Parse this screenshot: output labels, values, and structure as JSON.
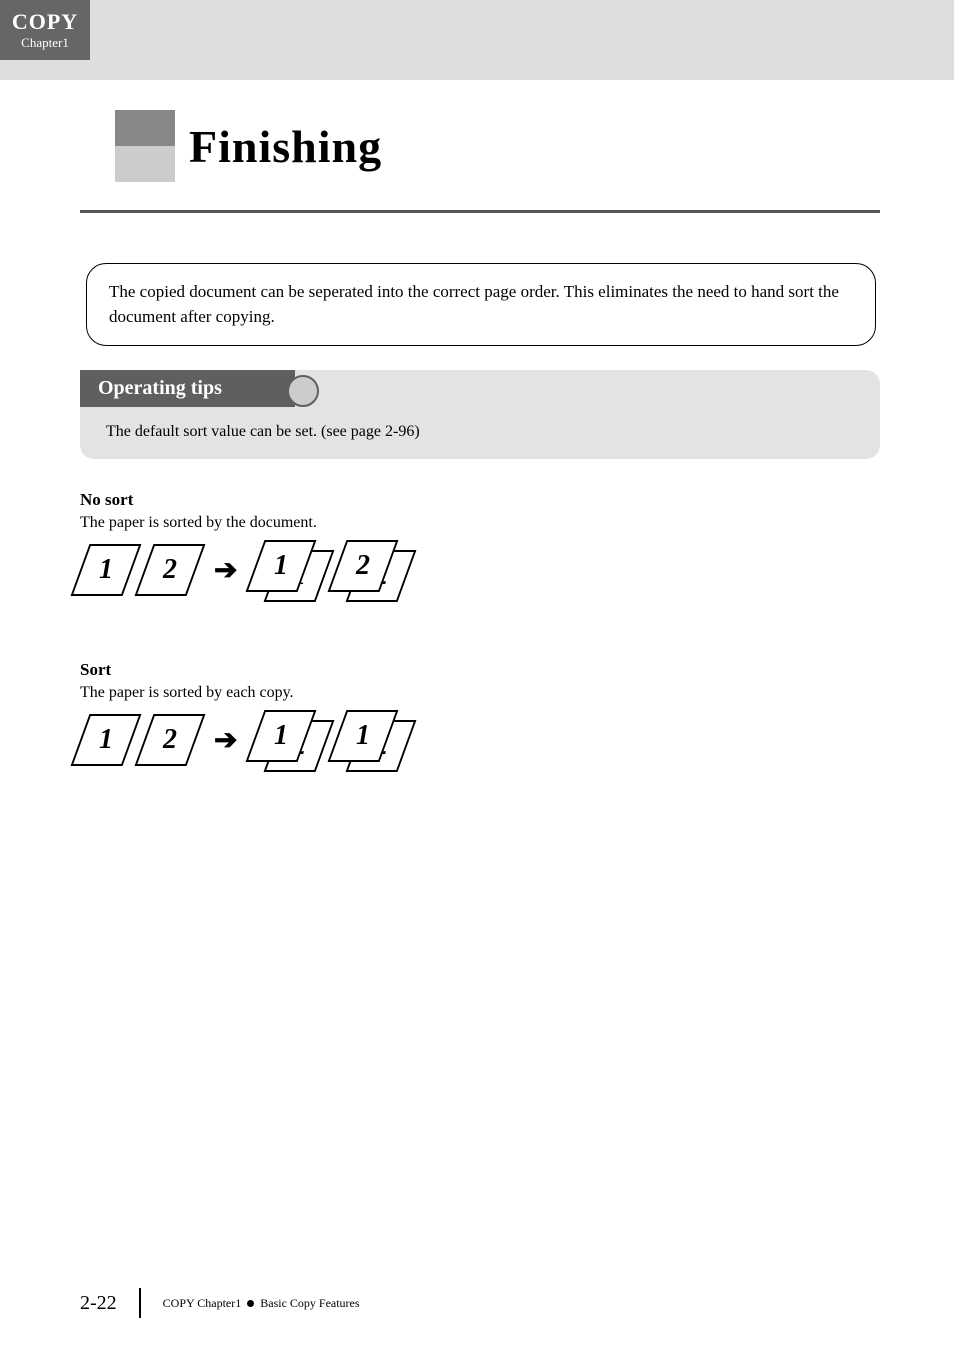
{
  "tab": {
    "title": "COPY",
    "sub": "Chapter1"
  },
  "heading": "Finishing",
  "callout": "The copied document can be seperated into the correct page order. This eliminates the need to hand sort the document after copying.",
  "tips": {
    "heading": "Operating tips",
    "body": "The default sort value can be set. (see page 2-96)"
  },
  "nosort": {
    "title": "No sort",
    "sub": "The paper is sorted by the document.",
    "left": [
      "1",
      "2"
    ],
    "right": [
      {
        "front": "1",
        "back": "1"
      },
      {
        "front": "2",
        "back": "2"
      }
    ]
  },
  "sort": {
    "title": "Sort",
    "sub": "The paper is sorted by each copy.",
    "left": [
      "1",
      "2"
    ],
    "right": [
      {
        "front": "1",
        "back": "2"
      },
      {
        "front": "1",
        "back": "2"
      }
    ]
  },
  "footer": {
    "page": "2-22",
    "left": "COPY Chapter1",
    "right": "Basic Copy Features"
  }
}
